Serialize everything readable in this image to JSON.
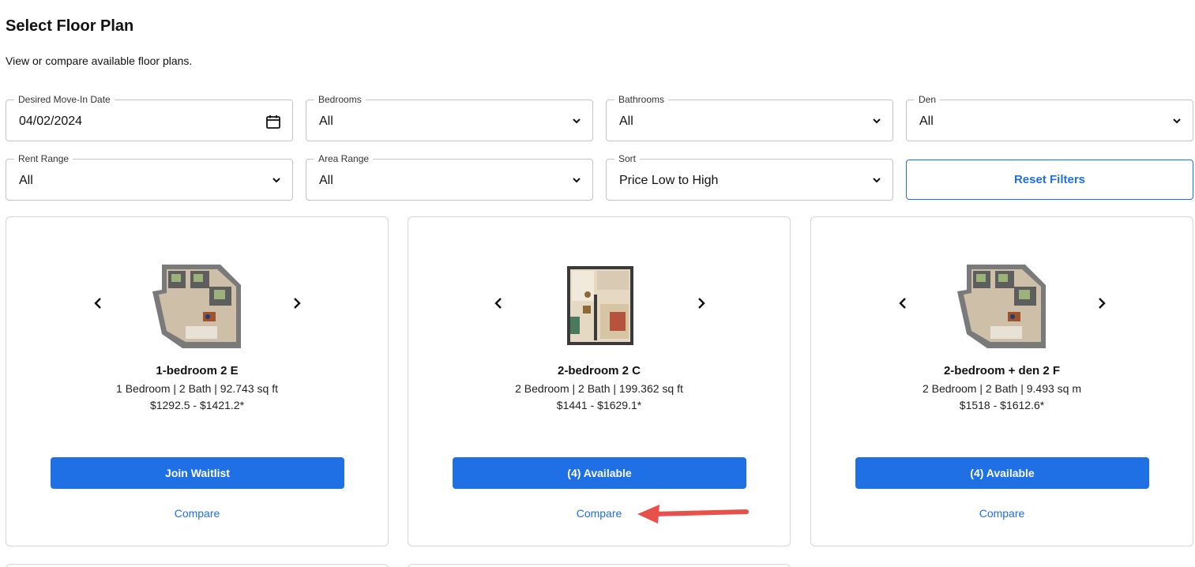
{
  "header": {
    "title": "Select Floor Plan",
    "subtitle": "View or compare available floor plans."
  },
  "filters": {
    "move_in": {
      "label": "Desired Move-In Date",
      "value": "04/02/2024",
      "icon": "calendar-icon"
    },
    "bedrooms": {
      "label": "Bedrooms",
      "value": "All"
    },
    "bathrooms": {
      "label": "Bathrooms",
      "value": "All"
    },
    "den": {
      "label": "Den",
      "value": "All"
    },
    "rent_range": {
      "label": "Rent Range",
      "value": "All"
    },
    "area_range": {
      "label": "Area Range",
      "value": "All"
    },
    "sort": {
      "label": "Sort",
      "value": "Price Low to High"
    },
    "reset_label": "Reset Filters"
  },
  "cards": [
    {
      "title": "1-bedroom 2 E",
      "meta": "1 Bedroom | 2 Bath | 92.743 sq ft",
      "price": "$1292.5 - $1421.2*",
      "button": "Join Waitlist",
      "compare": "Compare"
    },
    {
      "title": "2-bedroom 2 C",
      "meta": "2 Bedroom | 2 Bath | 199.362 sq ft",
      "price": "$1441 - $1629.1*",
      "button": "(4) Available",
      "compare": "Compare"
    },
    {
      "title": "2-bedroom + den 2 F",
      "meta": "2 Bedroom | 2 Bath | 9.493 sq m",
      "price": "$1518 - $1612.6*",
      "button": "(4) Available",
      "compare": "Compare"
    }
  ],
  "colors": {
    "accent": "#1f6fe5",
    "annotation": "#e8514a",
    "border": "#c4c4c4"
  },
  "icons": {
    "prev": "chevron-left-icon",
    "next": "chevron-right-icon",
    "dropdown": "chevron-down-icon",
    "annotation": "red-arrow-annotation"
  }
}
